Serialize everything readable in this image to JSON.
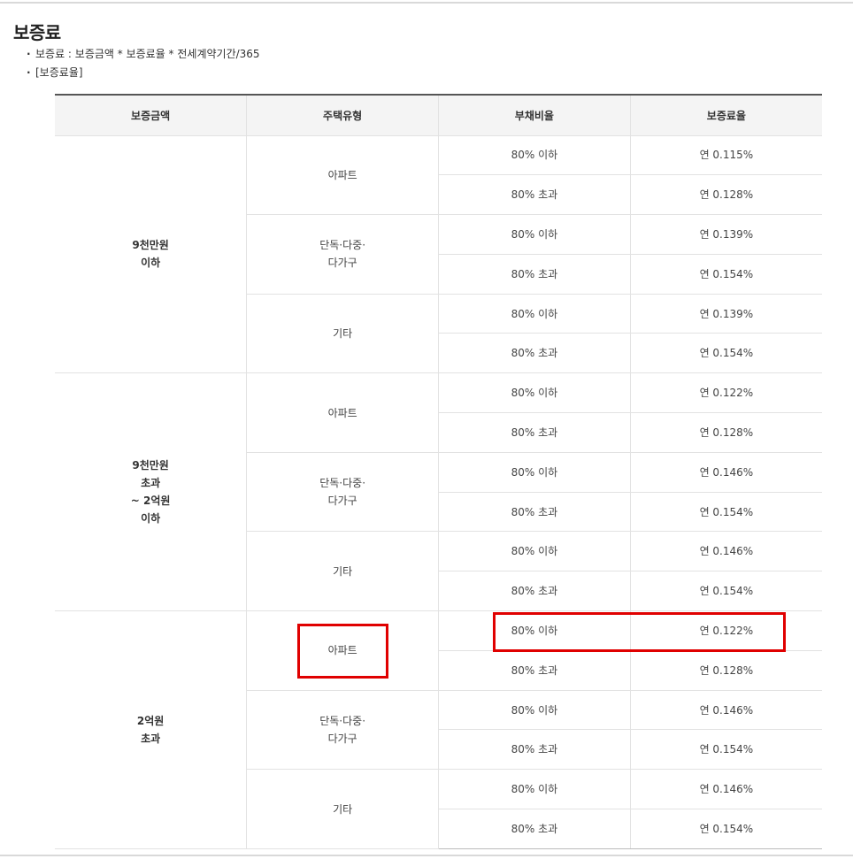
{
  "title": "보증료",
  "bullets": [
    "보증료 : 보증금액 * 보증료율 * 전세계약기간/365",
    "[보증료율]"
  ],
  "table": {
    "headers": [
      "보증금액",
      "주택유형",
      "부채비율",
      "보증료율"
    ],
    "groups": [
      {
        "amount": "9천만원\n이하",
        "types": [
          {
            "name": "아파트",
            "rows": [
              {
                "ratio": "80% 이하",
                "rate": "연 0.115%"
              },
              {
                "ratio": "80% 초과",
                "rate": "연 0.128%"
              }
            ]
          },
          {
            "name": "단독·다중·\n다가구",
            "rows": [
              {
                "ratio": "80% 이하",
                "rate": "연 0.139%"
              },
              {
                "ratio": "80% 초과",
                "rate": "연 0.154%"
              }
            ]
          },
          {
            "name": "기타",
            "rows": [
              {
                "ratio": "80% 이하",
                "rate": "연 0.139%"
              },
              {
                "ratio": "80% 초과",
                "rate": "연 0.154%"
              }
            ]
          }
        ]
      },
      {
        "amount": "9천만원\n초과\n~ 2억원\n이하",
        "types": [
          {
            "name": "아파트",
            "rows": [
              {
                "ratio": "80% 이하",
                "rate": "연 0.122%"
              },
              {
                "ratio": "80% 초과",
                "rate": "연 0.128%"
              }
            ]
          },
          {
            "name": "단독·다중·\n다가구",
            "rows": [
              {
                "ratio": "80% 이하",
                "rate": "연 0.146%"
              },
              {
                "ratio": "80% 초과",
                "rate": "연 0.154%"
              }
            ]
          },
          {
            "name": "기타",
            "rows": [
              {
                "ratio": "80% 이하",
                "rate": "연 0.146%"
              },
              {
                "ratio": "80% 초과",
                "rate": "연 0.154%"
              }
            ]
          }
        ]
      },
      {
        "amount": "2억원\n초과",
        "types": [
          {
            "name": "아파트",
            "rows": [
              {
                "ratio": "80% 이하",
                "rate": "연 0.122%"
              },
              {
                "ratio": "80% 초과",
                "rate": "연 0.128%"
              }
            ]
          },
          {
            "name": "단독·다중·\n다가구",
            "rows": [
              {
                "ratio": "80% 이하",
                "rate": "연 0.146%"
              },
              {
                "ratio": "80% 초과",
                "rate": "연 0.154%"
              }
            ]
          },
          {
            "name": "기타",
            "rows": [
              {
                "ratio": "80% 이하",
                "rate": "연 0.146%"
              },
              {
                "ratio": "80% 초과",
                "rate": "연 0.154%"
              }
            ]
          }
        ]
      }
    ]
  },
  "highlight_color": "#e00000"
}
